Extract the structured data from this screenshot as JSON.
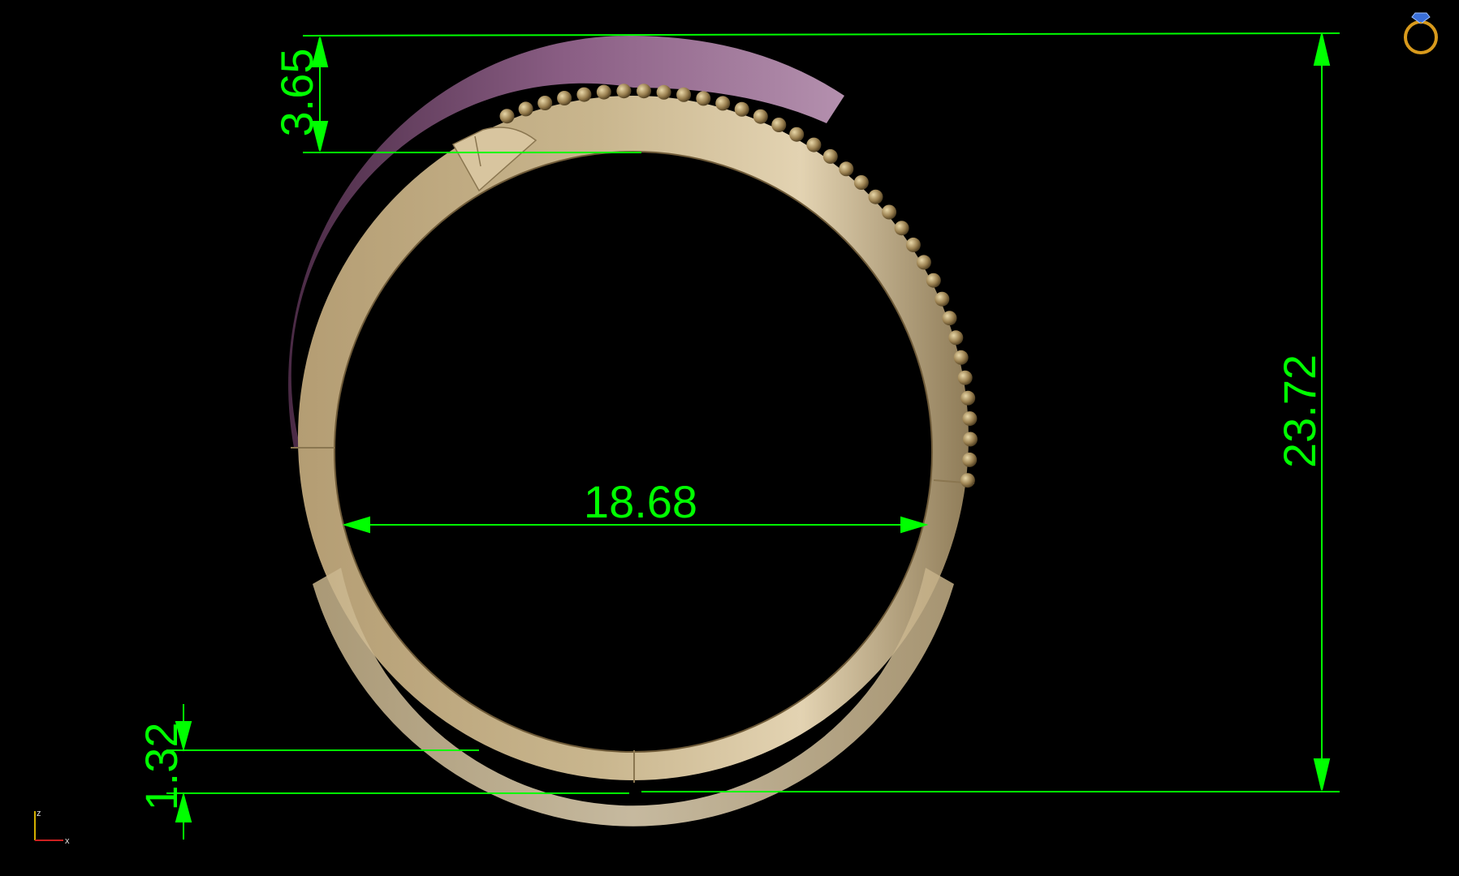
{
  "dimensions": {
    "top_width": "3.65",
    "inner_diameter": "18.68",
    "total_height": "23.72",
    "bottom_thickness": "1.32"
  },
  "axes": {
    "vertical": "z",
    "horizontal": "x"
  },
  "colors": {
    "dimension_lines": "#00ff00",
    "metal_gold": "#d6c39c",
    "purple_band": "#8e6286",
    "background": "#000000",
    "axis_z": "#d4b000",
    "axis_x": "#cc2020"
  },
  "icons": {
    "corner_logo": "ring-icon",
    "axis_indicator": "axis-icon"
  }
}
